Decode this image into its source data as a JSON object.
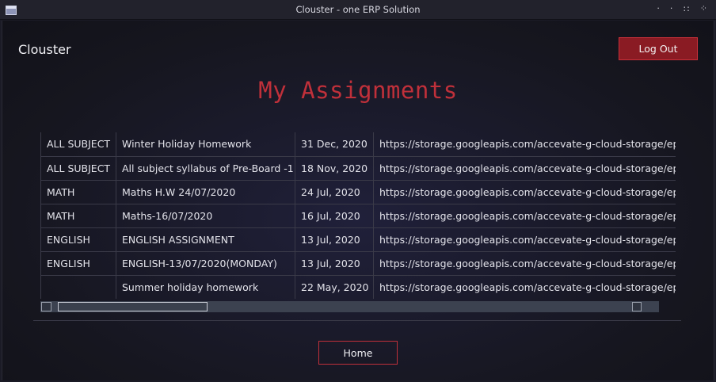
{
  "window": {
    "title": "Clouster - one ERP Solution",
    "controls": [
      "·",
      "·",
      "::",
      "⁘"
    ]
  },
  "header": {
    "brand": "Clouster",
    "logout_label": "Log Out"
  },
  "main": {
    "page_title": "My Assignments",
    "assignments": [
      {
        "subject": "ALL SUBJECT",
        "title": "Winter Holiday Homework",
        "date": "31 Dec, 2020",
        "link": "https://storage.googleapis.com/accevate-g-cloud-storage/epar"
      },
      {
        "subject": "ALL SUBJECT",
        "title": "All subject syllabus of Pre-Board -1",
        "date": "18 Nov, 2020",
        "link": "https://storage.googleapis.com/accevate-g-cloud-storage/epar"
      },
      {
        "subject": "MATH",
        "title": "Maths H.W 24/07/2020",
        "date": "24 Jul, 2020",
        "link": "https://storage.googleapis.com/accevate-g-cloud-storage/epar"
      },
      {
        "subject": "MATH",
        "title": "Maths-16/07/2020",
        "date": "16 Jul, 2020",
        "link": "https://storage.googleapis.com/accevate-g-cloud-storage/epar"
      },
      {
        "subject": "ENGLISH",
        "title": "ENGLISH ASSIGNMENT",
        "date": "13 Jul, 2020",
        "link": "https://storage.googleapis.com/accevate-g-cloud-storage/epar"
      },
      {
        "subject": "ENGLISH",
        "title": "ENGLISH-13/07/2020(MONDAY)",
        "date": "13 Jul, 2020",
        "link": "https://storage.googleapis.com/accevate-g-cloud-storage/epar"
      },
      {
        "subject": "",
        "title": "Summer holiday homework",
        "date": "22 May, 2020",
        "link": "https://storage.googleapis.com/accevate-g-cloud-storage/epar"
      }
    ],
    "home_label": "Home"
  }
}
